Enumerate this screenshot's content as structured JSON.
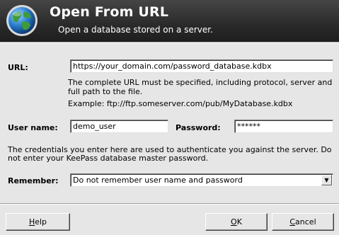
{
  "banner": {
    "title": "Open From URL",
    "subtitle": "Open a database stored on a server."
  },
  "url": {
    "label": "URL:",
    "value": "https://your_domain.com/password_database.kdbx",
    "hint": "The complete URL must be specified, including protocol, server and full path to the file.",
    "example": "Example: ftp://ftp.someserver.com/pub/MyDatabase.kdbx"
  },
  "user": {
    "label": "User name:",
    "value": "demo_user"
  },
  "password": {
    "label": "Password:",
    "value": "******"
  },
  "credentials_note": "The credentials you enter here are used to authenticate you against the server. Do not enter your KeePass database master password.",
  "remember": {
    "label": "Remember:",
    "selected": "Do not remember user name and password",
    "arrow_icon": "dropdown-arrow"
  },
  "buttons": {
    "help": {
      "mnemonic": "H",
      "rest": "elp"
    },
    "ok": {
      "mnemonic": "O",
      "rest": "K"
    },
    "cancel": {
      "mnemonic": "C",
      "rest": "ancel"
    }
  },
  "colors": {
    "banner": "#2a2a2a",
    "dialog": "#e6e6e6"
  }
}
